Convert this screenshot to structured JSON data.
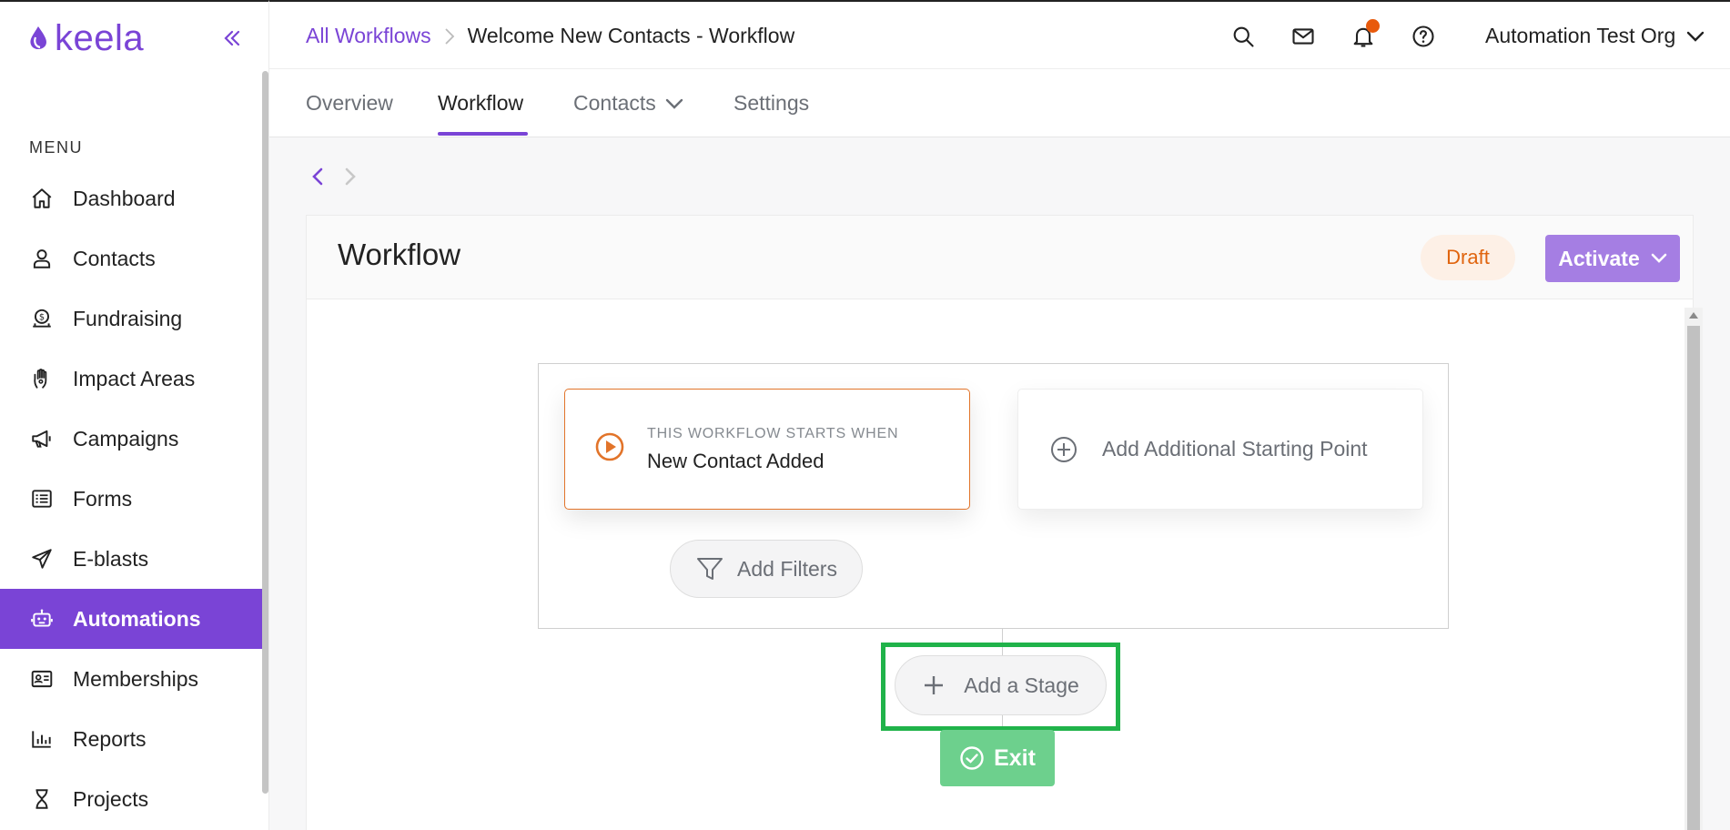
{
  "app": {
    "logo_text": "keela"
  },
  "sidebar": {
    "menu_label": "MENU",
    "items": [
      {
        "label": "Dashboard",
        "icon": "home-icon"
      },
      {
        "label": "Contacts",
        "icon": "user-icon"
      },
      {
        "label": "Fundraising",
        "icon": "donation-icon"
      },
      {
        "label": "Impact Areas",
        "icon": "hand-icon"
      },
      {
        "label": "Campaigns",
        "icon": "megaphone-icon"
      },
      {
        "label": "Forms",
        "icon": "form-icon"
      },
      {
        "label": "E-blasts",
        "icon": "paper-plane-icon"
      },
      {
        "label": "Automations",
        "icon": "robot-icon",
        "active": true
      },
      {
        "label": "Memberships",
        "icon": "id-card-icon"
      },
      {
        "label": "Reports",
        "icon": "bar-chart-icon"
      },
      {
        "label": "Projects",
        "icon": "hourglass-icon"
      }
    ]
  },
  "header": {
    "breadcrumb_parent": "All Workflows",
    "breadcrumb_current": "Welcome New Contacts - Workflow",
    "org_name": "Automation Test Org",
    "icons": [
      "search-icon",
      "mail-icon",
      "bell-icon",
      "help-icon"
    ]
  },
  "tabs": [
    {
      "label": "Overview"
    },
    {
      "label": "Workflow",
      "active": true
    },
    {
      "label": "Contacts",
      "has_dropdown": true
    },
    {
      "label": "Settings"
    }
  ],
  "panel": {
    "title": "Workflow",
    "status_badge": "Draft",
    "activate_label": "Activate"
  },
  "workflow": {
    "trigger_subtitle": "THIS WORKFLOW STARTS WHEN",
    "trigger_title": "New Contact Added",
    "add_start_label": "Add Additional Starting Point",
    "add_filters_label": "Add Filters",
    "add_stage_label": "Add a Stage",
    "exit_label": "Exit"
  },
  "colors": {
    "brand_purple": "#7a44d6",
    "activate_purple": "#a57ee3",
    "trigger_orange": "#e2742a",
    "highlight_green": "#20b34a",
    "exit_green": "#6dd08d"
  }
}
